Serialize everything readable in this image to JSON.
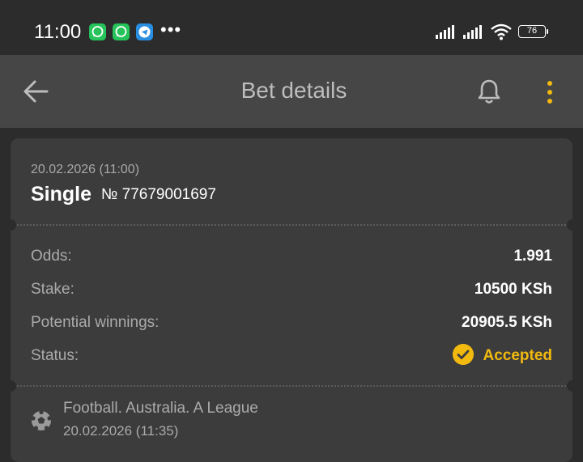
{
  "status_bar": {
    "time": "11:00",
    "more": "•••",
    "battery": "76",
    "icons": [
      "whatsapp-icon",
      "whatsapp-icon",
      "telegram-icon",
      "signal-icon",
      "signal-icon",
      "wifi-icon",
      "battery-icon"
    ]
  },
  "app_bar": {
    "title": "Bet details",
    "icons": [
      "back-arrow-icon",
      "bell-icon",
      "more-vert-icon"
    ]
  },
  "bet": {
    "date": "20.02.2026 (11:00)",
    "type": "Single",
    "number": "№ 77679001697"
  },
  "details": [
    {
      "label": "Odds:",
      "value": "1.991"
    },
    {
      "label": "Stake:",
      "value": "10500 KSh"
    },
    {
      "label": "Potential winnings:",
      "value": "20905.5 KSh"
    },
    {
      "label": "Status:",
      "value": "Accepted"
    }
  ],
  "event": {
    "title": "Football. Australia. A League",
    "date": "20.02.2026 (11:35)",
    "icon": "football-icon"
  },
  "colors": {
    "background": "#2c2c2c",
    "app_bar": "#464646",
    "card": "#3c3c3c",
    "accent": "#f2b90f"
  }
}
